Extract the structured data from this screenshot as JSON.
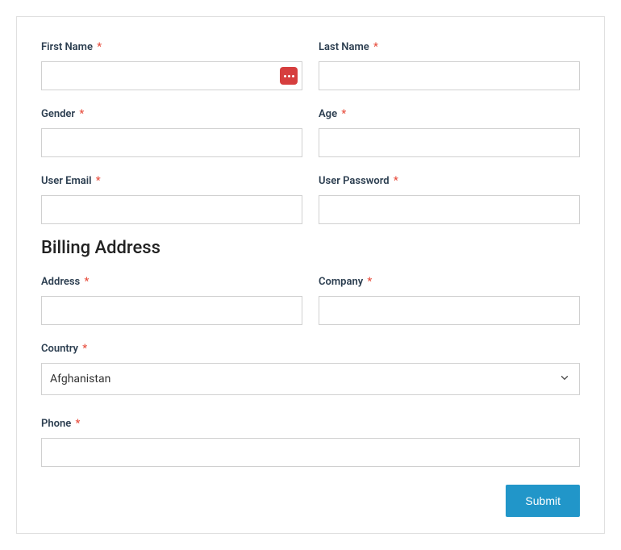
{
  "fields": {
    "first_name": {
      "label": "First Name",
      "value": ""
    },
    "last_name": {
      "label": "Last Name",
      "value": ""
    },
    "gender": {
      "label": "Gender",
      "value": ""
    },
    "age": {
      "label": "Age",
      "value": ""
    },
    "user_email": {
      "label": "User Email",
      "value": ""
    },
    "user_password": {
      "label": "User Password",
      "value": ""
    },
    "address": {
      "label": "Address",
      "value": ""
    },
    "company": {
      "label": "Company",
      "value": ""
    },
    "country": {
      "label": "Country",
      "value": "Afghanistan"
    },
    "phone": {
      "label": "Phone",
      "value": ""
    }
  },
  "required_marker": "*",
  "section_title": "Billing Address",
  "submit_label": "Submit"
}
